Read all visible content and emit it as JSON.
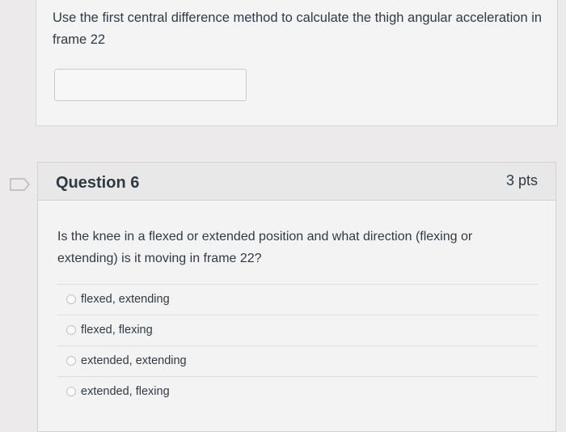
{
  "previous_question": {
    "text": "Use the first central difference method to calculate the thigh angular acceleration in frame 22",
    "answer_value": ""
  },
  "question": {
    "title": "Question 6",
    "points": "3 pts",
    "text": "Is the knee in a flexed or extended position and what direction (flexing or extending) is it moving in frame 22?",
    "flag_icon": "bookmark-flag-icon",
    "options": [
      {
        "label": "flexed, extending"
      },
      {
        "label": "flexed, flexing"
      },
      {
        "label": "extended, extending"
      },
      {
        "label": "extended, flexing"
      }
    ]
  }
}
